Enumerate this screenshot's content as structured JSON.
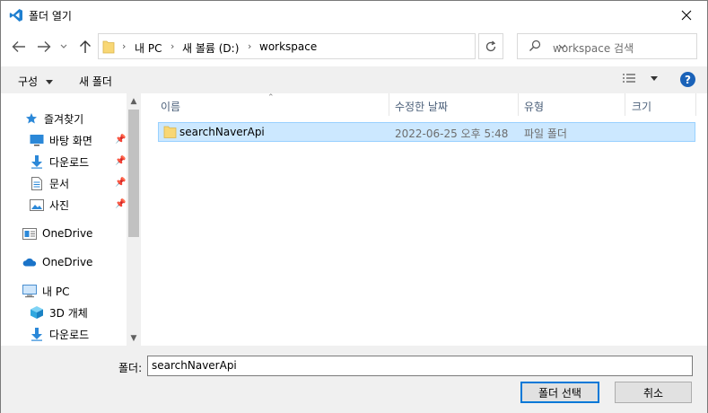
{
  "window": {
    "title": "폴더 열기",
    "close_icon": "close-icon",
    "app_icon": "vscode-icon"
  },
  "address": {
    "segments": [
      "내 PC",
      "새 볼륨 (D:)",
      "workspace"
    ]
  },
  "search": {
    "placeholder": "workspace 검색"
  },
  "toolbar": {
    "organize": "구성",
    "new_folder": "새 폴더",
    "help": "?"
  },
  "nav": {
    "items": [
      {
        "label": "즐겨찾기",
        "icon": "star-icon"
      },
      {
        "label": "바탕 화면",
        "icon": "desktop-icon",
        "pinned": true
      },
      {
        "label": "다운로드",
        "icon": "download-icon",
        "pinned": true
      },
      {
        "label": "문서",
        "icon": "document-icon",
        "pinned": true
      },
      {
        "label": "사진",
        "icon": "picture-icon",
        "pinned": true
      },
      {
        "label": "OneDrive",
        "icon": "onedrive-business-icon"
      },
      {
        "label": "OneDrive",
        "icon": "onedrive-icon"
      },
      {
        "label": "내 PC",
        "icon": "pc-icon"
      },
      {
        "label": "3D 개체",
        "icon": "3d-objects-icon"
      },
      {
        "label": "다운로드",
        "icon": "download-icon"
      }
    ]
  },
  "columns": {
    "name": "이름",
    "modified": "수정한 날짜",
    "type": "유형",
    "size": "크기"
  },
  "files": [
    {
      "name": "searchNaverApi",
      "modified": "2022-06-25 오후 5:48",
      "type": "파일 폴더",
      "size": ""
    }
  ],
  "bottom": {
    "label": "폴더:",
    "value": "searchNaverApi",
    "select_button": "폴더 선택",
    "cancel_button": "취소"
  },
  "colors": {
    "accent": "#0078d7",
    "selection": "#cce8ff",
    "folder": "#f8d775"
  }
}
